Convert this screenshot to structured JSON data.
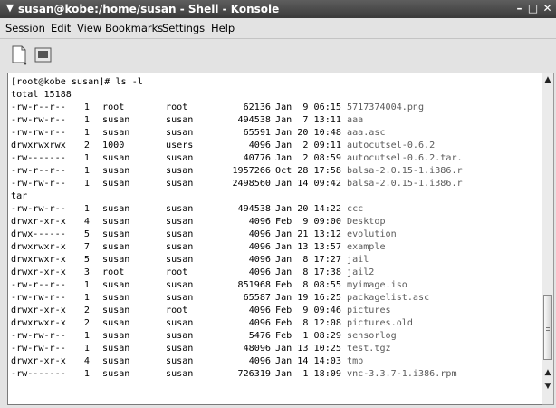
{
  "window": {
    "title": "susan@kobe:/home/susan - Shell - Konsole"
  },
  "menu": [
    "Session",
    "Edit",
    "View",
    "Bookmarks",
    "Settings",
    "Help"
  ],
  "terminal": {
    "prompt": "[root@kobe susan]# ls -l",
    "total": "total 15188",
    "rows": [
      {
        "perm": "-rw-r--r--",
        "links": "1",
        "owner": "root",
        "group": "root",
        "size": "62136",
        "date": "Jan  9 06:15",
        "name": "5717374004.png"
      },
      {
        "perm": "-rw-rw-r--",
        "links": "1",
        "owner": "susan",
        "group": "susan",
        "size": "494538",
        "date": "Jan  7 13:11",
        "name": "aaa"
      },
      {
        "perm": "-rw-rw-r--",
        "links": "1",
        "owner": "susan",
        "group": "susan",
        "size": "65591",
        "date": "Jan 20 10:48",
        "name": "aaa.asc"
      },
      {
        "perm": "drwxrwxrwx",
        "links": "2",
        "owner": "1000",
        "group": "users",
        "size": "4096",
        "date": "Jan  2 09:11",
        "name": "autocutsel-0.6.2"
      },
      {
        "perm": "-rw-------",
        "links": "1",
        "owner": "susan",
        "group": "susan",
        "size": "40776",
        "date": "Jan  2 08:59",
        "name": "autocutsel-0.6.2.tar."
      },
      {
        "perm": "-rw-r--r--",
        "links": "1",
        "owner": "susan",
        "group": "susan",
        "size": "1957266",
        "date": "Oct 28 17:58",
        "name": "balsa-2.0.15-1.i386.r"
      },
      {
        "perm": "-rw-rw-r--",
        "links": "1",
        "owner": "susan",
        "group": "susan",
        "size": "2498560",
        "date": "Jan 14 09:42",
        "name": "balsa-2.0.15-1.i386.r"
      },
      {
        "perm": "tar",
        "links": "",
        "owner": "",
        "group": "",
        "size": "",
        "date": "",
        "name": ""
      },
      {
        "perm": "-rw-rw-r--",
        "links": "1",
        "owner": "susan",
        "group": "susan",
        "size": "494538",
        "date": "Jan 20 14:22",
        "name": "ccc"
      },
      {
        "perm": "drwxr-xr-x",
        "links": "4",
        "owner": "susan",
        "group": "susan",
        "size": "4096",
        "date": "Feb  9 09:00",
        "name": "Desktop"
      },
      {
        "perm": "drwx------",
        "links": "5",
        "owner": "susan",
        "group": "susan",
        "size": "4096",
        "date": "Jan 21 13:12",
        "name": "evolution"
      },
      {
        "perm": "drwxrwxr-x",
        "links": "7",
        "owner": "susan",
        "group": "susan",
        "size": "4096",
        "date": "Jan 13 13:57",
        "name": "example"
      },
      {
        "perm": "drwxrwxr-x",
        "links": "5",
        "owner": "susan",
        "group": "susan",
        "size": "4096",
        "date": "Jan  8 17:27",
        "name": "jail"
      },
      {
        "perm": "drwxr-xr-x",
        "links": "3",
        "owner": "root",
        "group": "root",
        "size": "4096",
        "date": "Jan  8 17:38",
        "name": "jail2"
      },
      {
        "perm": "-rw-r--r--",
        "links": "1",
        "owner": "susan",
        "group": "susan",
        "size": "851968",
        "date": "Feb  8 08:55",
        "name": "myimage.iso"
      },
      {
        "perm": "-rw-rw-r--",
        "links": "1",
        "owner": "susan",
        "group": "susan",
        "size": "65587",
        "date": "Jan 19 16:25",
        "name": "packagelist.asc"
      },
      {
        "perm": "drwxr-xr-x",
        "links": "2",
        "owner": "susan",
        "group": "root",
        "size": "4096",
        "date": "Feb  9 09:46",
        "name": "pictures"
      },
      {
        "perm": "drwxrwxr-x",
        "links": "2",
        "owner": "susan",
        "group": "susan",
        "size": "4096",
        "date": "Feb  8 12:08",
        "name": "pictures.old"
      },
      {
        "perm": "-rw-rw-r--",
        "links": "1",
        "owner": "susan",
        "group": "susan",
        "size": "5476",
        "date": "Feb  1 08:29",
        "name": "sensorlog"
      },
      {
        "perm": "-rw-rw-r--",
        "links": "1",
        "owner": "susan",
        "group": "susan",
        "size": "48096",
        "date": "Jan 13 10:25",
        "name": "test.tgz"
      },
      {
        "perm": "drwxr-xr-x",
        "links": "4",
        "owner": "susan",
        "group": "susan",
        "size": "4096",
        "date": "Jan 14 14:03",
        "name": "tmp"
      },
      {
        "perm": "-rw-------",
        "links": "1",
        "owner": "susan",
        "group": "susan",
        "size": "726319",
        "date": "Jan  1 18:09",
        "name": "vnc-3.3.7-1.i386.rpm"
      }
    ]
  },
  "icons": {
    "window_menu": "chevron-down-icon",
    "minimize": "minimize-icon",
    "maximize": "maximize-icon",
    "close": "close-icon",
    "new_session": "new-session-icon",
    "terminal": "terminal-icon"
  },
  "colors": {
    "titlebar": "#4a4a4a",
    "filename": "#5b5b5b"
  }
}
